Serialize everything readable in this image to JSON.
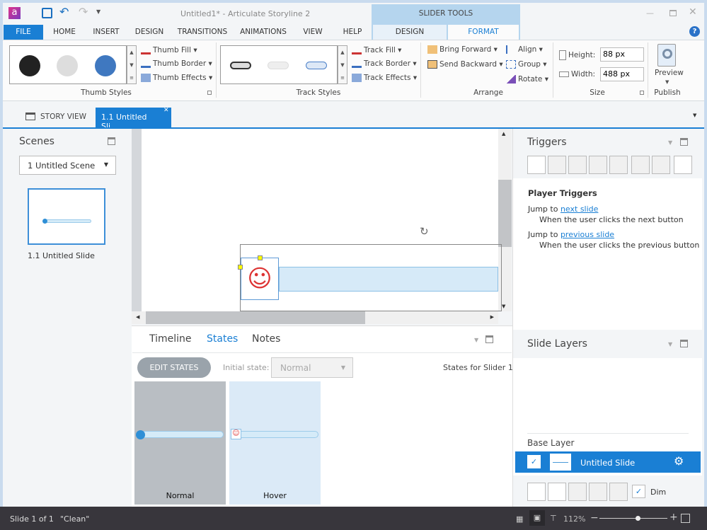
{
  "window": {
    "title": "Untitled1* -  Articulate Storyline 2",
    "contextual_tab": "SLIDER TOOLS"
  },
  "menu": {
    "tabs": [
      "FILE",
      "HOME",
      "INSERT",
      "DESIGN",
      "TRANSITIONS",
      "ANIMATIONS",
      "VIEW",
      "HELP",
      "DESIGN",
      "FORMAT"
    ],
    "active": "FORMAT"
  },
  "ribbon": {
    "thumb": {
      "fill": "Thumb Fill",
      "border": "Thumb Border",
      "effects": "Thumb Effects",
      "group": "Thumb Styles"
    },
    "track": {
      "fill": "Track Fill",
      "border": "Track Border",
      "effects": "Track Effects",
      "group": "Track Styles"
    },
    "arrange": {
      "bring_forward": "Bring Forward",
      "send_backward": "Send Backward",
      "align": "Align",
      "group_cmd": "Group",
      "rotate": "Rotate",
      "group": "Arrange"
    },
    "size": {
      "height_label": "Height:",
      "height_value": "88 px",
      "width_label": "Width:",
      "width_value": "488 px",
      "group": "Size"
    },
    "publish": {
      "preview": "Preview",
      "group": "Publish"
    }
  },
  "doc_tabs": {
    "story_view": "STORY VIEW",
    "slide_tab": "1.1 Untitled Sli..."
  },
  "scenes": {
    "title": "Scenes",
    "selected": "1 Untitled Scene",
    "slide_label": "1.1 Untitled Slide"
  },
  "bottom_panel": {
    "tabs": [
      "Timeline",
      "States",
      "Notes"
    ],
    "active": "States",
    "edit_states": "EDIT STATES",
    "initial_state_label": "Initial state:",
    "initial_state_value": "Normal",
    "states_for": "States for Slider 1",
    "states": [
      "Normal",
      "Hover"
    ]
  },
  "triggers": {
    "title": "Triggers",
    "section": "Player Triggers",
    "items": [
      {
        "action": "Jump to ",
        "target": "next slide",
        "condition": "When the user clicks the next button"
      },
      {
        "action": "Jump to ",
        "target": "previous slide",
        "condition": "When the user clicks the previous button"
      }
    ]
  },
  "layers": {
    "title": "Slide Layers",
    "base": "Base Layer",
    "slide": "Untitled Slide",
    "dim": "Dim"
  },
  "status": {
    "slide": "Slide 1 of 1",
    "theme": "\"Clean\"",
    "zoom": "112%",
    "zoom_level": 0.55
  },
  "colors": {
    "accent": "#1a7fd4",
    "status_bar": "#38363c",
    "contextual": "#b5d5ee"
  }
}
